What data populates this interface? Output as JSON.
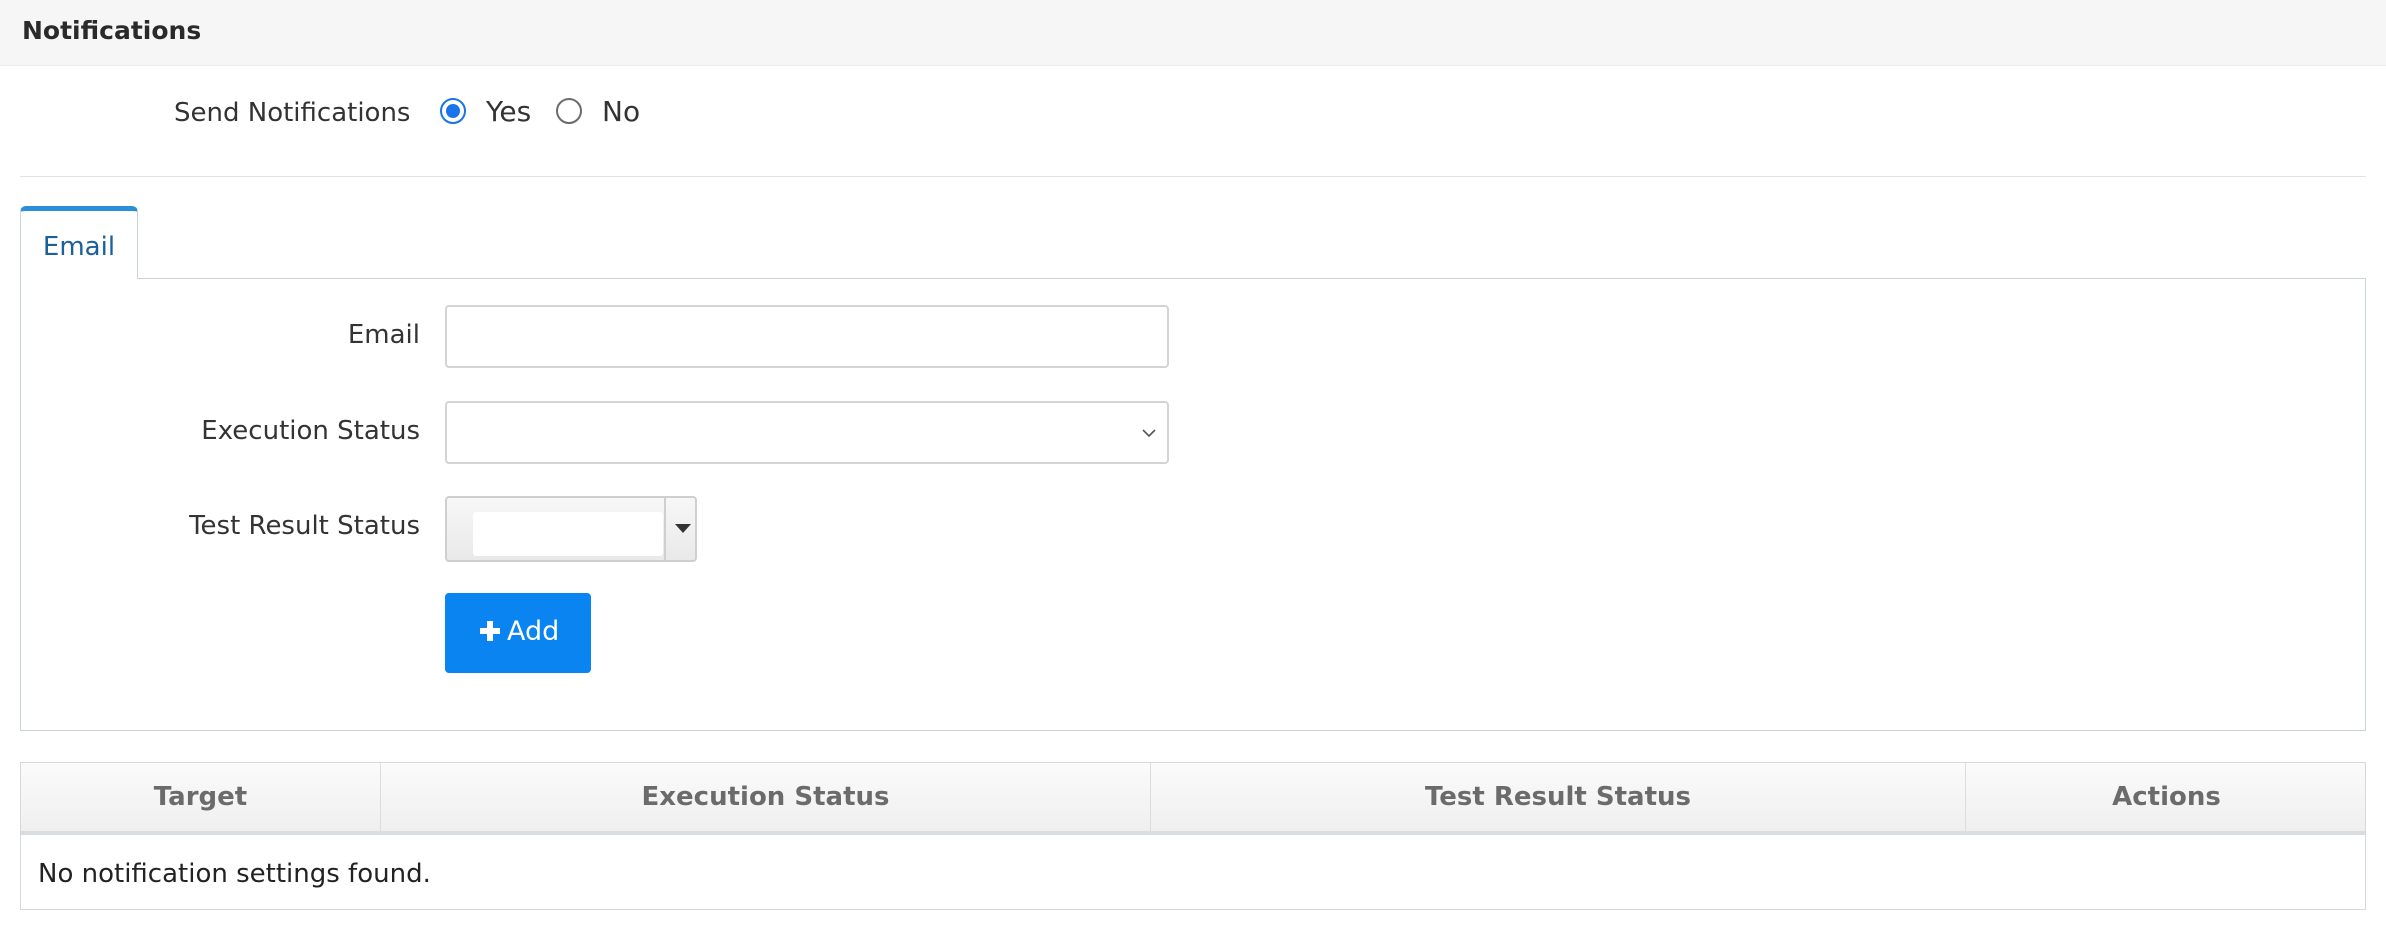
{
  "header": {
    "title": "Notifications"
  },
  "send_notifications": {
    "label": "Send Notifications",
    "options": [
      {
        "label": "Yes",
        "checked": true
      },
      {
        "label": "No",
        "checked": false
      }
    ]
  },
  "tabs": [
    {
      "label": "Email",
      "active": true
    }
  ],
  "form": {
    "email_label": "Email",
    "email_value": "",
    "execution_status_label": "Execution Status",
    "execution_status_value": "",
    "test_result_status_label": "Test Result Status",
    "test_result_status_value": "",
    "add_button_label": "Add"
  },
  "table": {
    "columns": [
      "Target",
      "Execution Status",
      "Test Result Status",
      "Actions"
    ],
    "empty_message": "No notification settings found."
  },
  "colors": {
    "accent": "#0a84f0",
    "tab_border": "#2a8fd8",
    "radio_checked": "#1a73e8"
  }
}
